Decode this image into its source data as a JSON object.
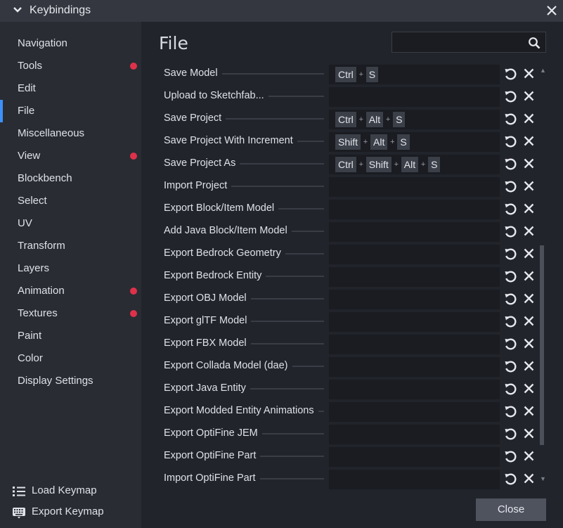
{
  "dialog": {
    "title": "Keybindings"
  },
  "sidebar": {
    "items": [
      {
        "label": "Navigation",
        "active": false,
        "modified": false
      },
      {
        "label": "Tools",
        "active": false,
        "modified": true
      },
      {
        "label": "Edit",
        "active": false,
        "modified": false
      },
      {
        "label": "File",
        "active": true,
        "modified": false
      },
      {
        "label": "Miscellaneous",
        "active": false,
        "modified": false
      },
      {
        "label": "View",
        "active": false,
        "modified": true
      },
      {
        "label": "Blockbench",
        "active": false,
        "modified": false
      },
      {
        "label": "Select",
        "active": false,
        "modified": false
      },
      {
        "label": "UV",
        "active": false,
        "modified": false
      },
      {
        "label": "Transform",
        "active": false,
        "modified": false
      },
      {
        "label": "Layers",
        "active": false,
        "modified": false
      },
      {
        "label": "Animation",
        "active": false,
        "modified": true
      },
      {
        "label": "Textures",
        "active": false,
        "modified": true
      },
      {
        "label": "Paint",
        "active": false,
        "modified": false
      },
      {
        "label": "Color",
        "active": false,
        "modified": false
      },
      {
        "label": "Display Settings",
        "active": false,
        "modified": false
      }
    ],
    "actions": [
      {
        "label": "Load Keymap",
        "icon": "list-icon"
      },
      {
        "label": "Export Keymap",
        "icon": "keyboard-icon"
      }
    ]
  },
  "main": {
    "title": "File",
    "search": {
      "value": "",
      "placeholder": ""
    },
    "rows": [
      {
        "name": "Save Model",
        "keys": [
          "Ctrl",
          "S"
        ]
      },
      {
        "name": "Upload to Sketchfab...",
        "keys": []
      },
      {
        "name": "Save Project",
        "keys": [
          "Ctrl",
          "Alt",
          "S"
        ]
      },
      {
        "name": "Save Project With Increment",
        "keys": [
          "Shift",
          "Alt",
          "S"
        ]
      },
      {
        "name": "Save Project As",
        "keys": [
          "Ctrl",
          "Shift",
          "Alt",
          "S"
        ]
      },
      {
        "name": "Import Project",
        "keys": []
      },
      {
        "name": "Export Block/Item Model",
        "keys": []
      },
      {
        "name": "Add Java Block/Item Model",
        "keys": []
      },
      {
        "name": "Export Bedrock Geometry",
        "keys": []
      },
      {
        "name": "Export Bedrock Entity",
        "keys": []
      },
      {
        "name": "Export OBJ Model",
        "keys": []
      },
      {
        "name": "Export glTF Model",
        "keys": []
      },
      {
        "name": "Export FBX Model",
        "keys": []
      },
      {
        "name": "Export Collada Model (dae)",
        "keys": []
      },
      {
        "name": "Export Java Entity",
        "keys": []
      },
      {
        "name": "Export Modded Entity Animations",
        "keys": []
      },
      {
        "name": "Export OptiFine JEM",
        "keys": []
      },
      {
        "name": "Export OptiFine Part",
        "keys": []
      },
      {
        "name": "Import OptiFine Part",
        "keys": []
      }
    ]
  },
  "footer": {
    "close_label": "Close"
  },
  "colors": {
    "accent": "#3e90ff",
    "modified_dot": "#e0314a",
    "sidebar_bg": "#292c33",
    "main_bg": "#21242b",
    "titlebar_bg": "#34373f"
  }
}
